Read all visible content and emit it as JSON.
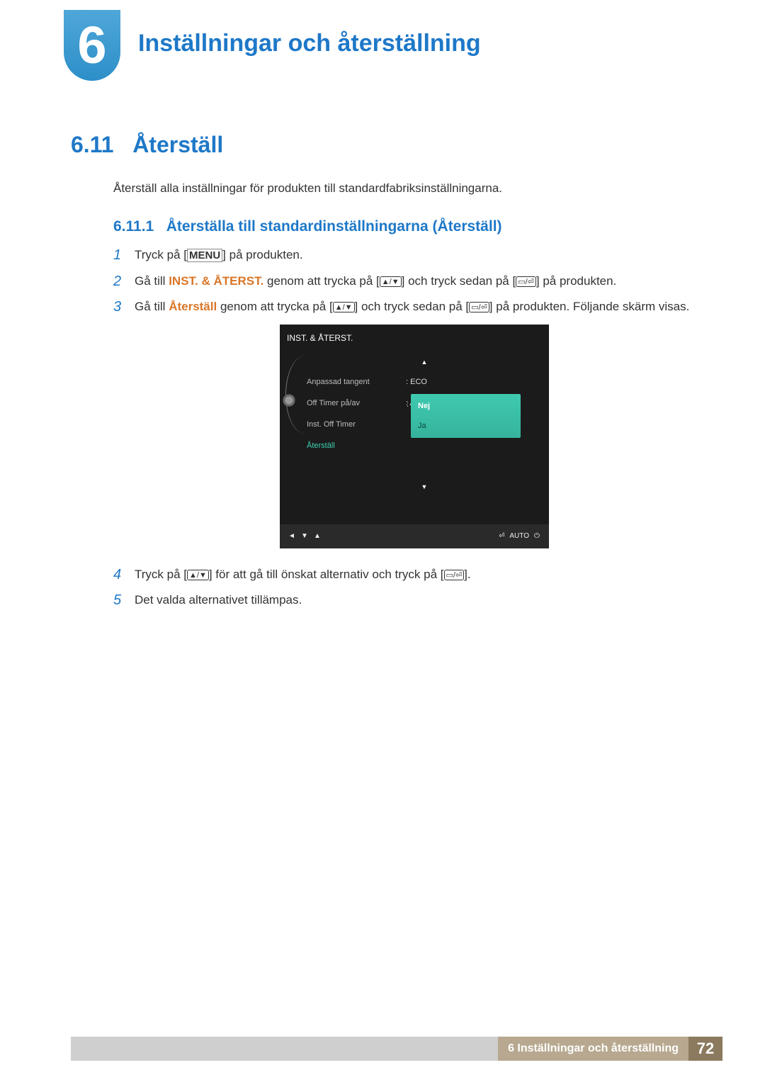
{
  "chapter": {
    "number": "6",
    "title": "Inställningar och återställning"
  },
  "section": {
    "number": "6.11",
    "title": "Återställ",
    "intro": "Återställ alla inställningar för produkten till standardfabriksinställningarna."
  },
  "subsection": {
    "number": "6.11.1",
    "title": "Återställa till standardinställningarna (Återställ)"
  },
  "steps": {
    "s1": {
      "num": "1",
      "pre": "Tryck på [",
      "key": "MENU",
      "post": "] på produkten."
    },
    "s2": {
      "num": "2",
      "pre": "Gå till ",
      "target": "INST. & ÅTERST.",
      "mid": " genom att trycka på [",
      "btn1": "▲/▼",
      "mid2": "] och tryck sedan på [",
      "btn2": "▭/⏎",
      "post": "] på produkten."
    },
    "s3": {
      "num": "3",
      "pre": "Gå till ",
      "target": "Återställ",
      "mid": " genom att trycka på [",
      "btn1": "▲/▼",
      "mid2": "] och tryck sedan på [",
      "btn2": "▭/⏎",
      "post": "] på produkten. Följande skärm visas."
    },
    "s4": {
      "num": "4",
      "pre": "Tryck på [",
      "btn1": "▲/▼",
      "mid": "] för att gå till önskat alternativ och tryck på [",
      "btn2": "▭/⏎",
      "post": "]."
    },
    "s5": {
      "num": "5",
      "text": "Det valda alternativet tillämpas."
    }
  },
  "osd": {
    "title": "INST. & ÅTERST.",
    "rows": [
      {
        "label": "Anpassad tangent",
        "value": "ECO"
      },
      {
        "label": "Off Timer på/av",
        "value": "Av"
      },
      {
        "label": "Inst. Off Timer",
        "value": ""
      },
      {
        "label": "Återställ",
        "value": ""
      }
    ],
    "popup": {
      "options": [
        "Nej",
        "Ja"
      ],
      "selected": "Nej"
    },
    "bottom": {
      "auto": "AUTO"
    }
  },
  "footer": {
    "label": "6 Inställningar och återställning",
    "page": "72"
  }
}
